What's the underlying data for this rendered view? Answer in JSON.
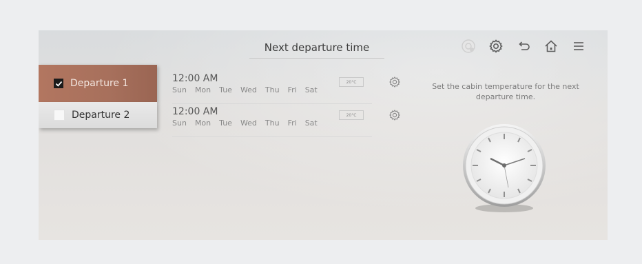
{
  "header": {
    "title": "Next departure time"
  },
  "toolbar": {
    "icons": [
      "temperature-icon",
      "settings-icon",
      "back-icon",
      "home-icon",
      "menu-icon"
    ]
  },
  "sidebar": {
    "items": [
      {
        "label": "Departure 1",
        "checked": true
      },
      {
        "label": "Departure 2",
        "checked": false
      }
    ]
  },
  "schedule": {
    "rows": [
      {
        "time": "12:00 AM",
        "days": [
          "Sun",
          "Mon",
          "Tue",
          "Wed",
          "Thu",
          "Fri",
          "Sat"
        ],
        "temp": "20°C"
      },
      {
        "time": "12:00 AM",
        "days": [
          "Sun",
          "Mon",
          "Tue",
          "Wed",
          "Thu",
          "Fri",
          "Sat"
        ],
        "temp": "20°C"
      }
    ]
  },
  "info": {
    "text": "Set the cabin temperature for the next departure time."
  },
  "colors": {
    "selected": "#a7705c",
    "background": "#e1dfdd"
  }
}
